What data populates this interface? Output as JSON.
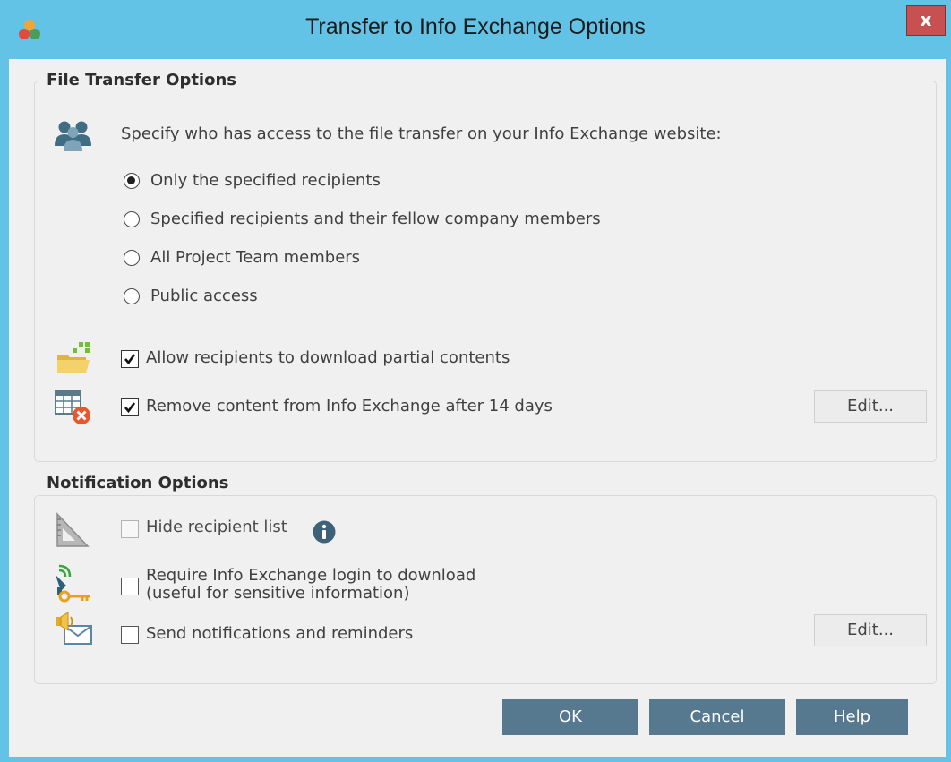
{
  "window": {
    "title": "Transfer to Info Exchange Options",
    "close_label": "x"
  },
  "file_transfer": {
    "heading": "File Transfer Options",
    "access_prompt": "Specify who has access to the file transfer on your Info Exchange website:",
    "access_options": [
      {
        "label": "Only the specified recipients",
        "selected": true
      },
      {
        "label": "Specified recipients and their fellow company members",
        "selected": false
      },
      {
        "label": "All Project Team members",
        "selected": false
      },
      {
        "label": "Public access",
        "selected": false
      }
    ],
    "allow_partial": {
      "label": "Allow recipients to download partial contents",
      "checked": true
    },
    "remove_content": {
      "label": "Remove content from Info Exchange after 14 days",
      "checked": true
    },
    "edit_label": "Edit..."
  },
  "notification": {
    "heading": "Notification Options",
    "hide_recipients": {
      "label": "Hide recipient list",
      "checked": false,
      "enabled": false
    },
    "require_login": {
      "label_line1": "Require Info Exchange login to download",
      "label_line2": "(useful for sensitive information)",
      "checked": false
    },
    "send_notifications": {
      "label": "Send notifications and reminders",
      "checked": false
    },
    "edit_label": "Edit..."
  },
  "footer": {
    "ok_label": "OK",
    "cancel_label": "Cancel",
    "help_label": "Help"
  },
  "colors": {
    "titlebar": "#62c3e7",
    "close_button": "#c75050",
    "primary_button": "#56798f",
    "info_icon": "#3c6178"
  },
  "icons": [
    "app-logo-icon",
    "people-icon",
    "folder-partial-icon",
    "calendar-remove-icon",
    "triangle-ruler-icon",
    "info-icon",
    "satellite-key-icon",
    "speaker-envelope-icon"
  ]
}
